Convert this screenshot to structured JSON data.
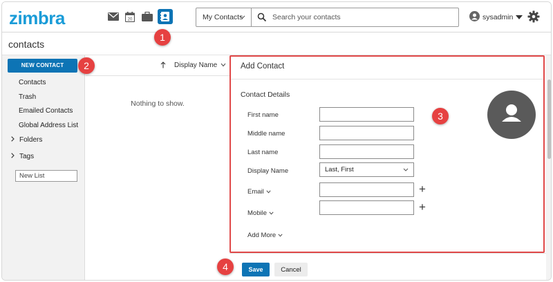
{
  "header": {
    "logo": "zimbra",
    "apps": [
      {
        "name": "mail-icon"
      },
      {
        "name": "calendar-icon",
        "badge": "20"
      },
      {
        "name": "briefcase-icon"
      },
      {
        "name": "contacts-icon",
        "active": true
      }
    ],
    "search": {
      "scope": "My Contacts",
      "placeholder": "Search your contacts"
    },
    "user": "sysadmin",
    "settings_icon": "gear-icon"
  },
  "page_title": "contacts",
  "sidebar": {
    "new_contact_label": "NEW CONTACT",
    "items": [
      "Contacts",
      "Trash",
      "Emailed Contacts",
      "Global Address List"
    ],
    "folders_label": "Folders",
    "tags_label": "Tags",
    "new_list_placeholder": "New List"
  },
  "list": {
    "sort_field": "Display Name",
    "empty_message": "Nothing to show."
  },
  "panel": {
    "title": "Add Contact",
    "section": "Contact Details",
    "fields": {
      "first_name": "First name",
      "middle_name": "Middle name",
      "last_name": "Last name",
      "display_name": "Display Name",
      "display_name_value": "Last, First",
      "email": "Email",
      "mobile": "Mobile"
    },
    "add_more": "Add More"
  },
  "footer": {
    "save_label": "Save",
    "cancel_label": "Cancel"
  },
  "callouts": [
    "1",
    "2",
    "3",
    "4"
  ],
  "colors": {
    "brand": "#1a9cd8",
    "primary_button": "#0d74b5",
    "highlight": "#e04848",
    "callout": "#e64141"
  }
}
